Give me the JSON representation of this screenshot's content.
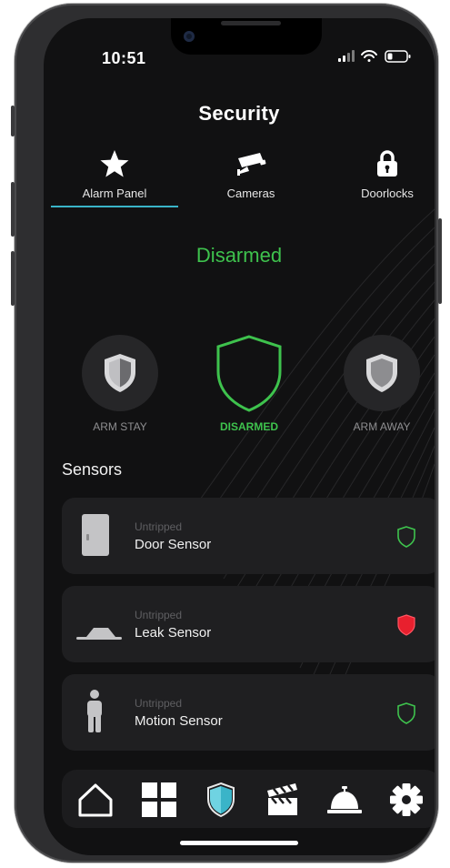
{
  "status_bar": {
    "time": "10:51"
  },
  "header": {
    "title": "Security"
  },
  "tabs": [
    {
      "label": "Alarm Panel",
      "icon": "star-icon",
      "active": true
    },
    {
      "label": "Cameras",
      "icon": "camera-icon",
      "active": false
    },
    {
      "label": "Doorlocks",
      "icon": "lock-icon",
      "active": false
    }
  ],
  "alarm": {
    "status": "Disarmed",
    "modes": [
      {
        "label": "ARM STAY",
        "icon": "shield-half-icon",
        "active": false
      },
      {
        "label": "DISARMED",
        "icon": "shield-outline-icon",
        "active": true
      },
      {
        "label": "ARM AWAY",
        "icon": "shield-full-icon",
        "active": false
      }
    ]
  },
  "sensors": {
    "title": "Sensors",
    "items": [
      {
        "state": "Untripped",
        "name": "Door Sensor",
        "icon": "door-icon",
        "status_icon": "shield-ok-icon"
      },
      {
        "state": "Untripped",
        "name": "Leak Sensor",
        "icon": "leak-icon",
        "status_icon": "shield-alert-icon"
      },
      {
        "state": "Untripped",
        "name": "Motion Sensor",
        "icon": "person-icon",
        "status_icon": "shield-ok-icon"
      }
    ]
  },
  "bottom_nav": [
    {
      "icon": "home-icon"
    },
    {
      "icon": "grid-icon"
    },
    {
      "icon": "shield-icon",
      "active": true
    },
    {
      "icon": "clapperboard-icon"
    },
    {
      "icon": "service-bell-icon"
    },
    {
      "icon": "gear-icon"
    }
  ],
  "colors": {
    "background": "#111112",
    "accent_green": "#3ec24d",
    "accent_teal": "#3ab4c8",
    "alert_red": "#e8202e",
    "card": "#1f1f21"
  }
}
